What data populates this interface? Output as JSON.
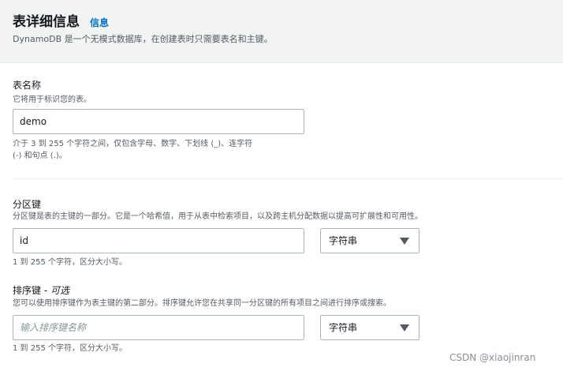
{
  "header": {
    "title": "表详细信息",
    "info_link": "信息",
    "description": "DynamoDB 是一个无模式数据库，在创建表时只需要表名和主键。"
  },
  "table_name": {
    "label": "表名称",
    "description": "它将用于标识您的表。",
    "value": "demo",
    "hint_line1": "介于 3 到 255 个字符之间，仅包含字母、数字、下划线 (_)、连字符",
    "hint_line2": "(-) 和句点 (.)。"
  },
  "partition_key": {
    "label": "分区键",
    "description": "分区键是表的主键的一部分。它是一个哈希值，用于从表中检索项目，以及跨主机分配数据以提高可扩展性和可用性。",
    "value": "id",
    "type_value": "字符串",
    "hint": "1 到 255 个字符，区分大小写。"
  },
  "sort_key": {
    "label": "排序键 - ",
    "label_optional": "可选",
    "description": "您可以使用排序键作为表主键的第二部分。排序键允许您在共享同一分区键的所有项目之间进行排序或搜索。",
    "value": "",
    "placeholder": "输入排序键名称",
    "type_value": "字符串",
    "hint": "1 到 255 个字符，区分大小写。"
  },
  "watermark": "CSDN @xiaojinran",
  "colors": {
    "header_bg": "#f2f3f3",
    "link": "#0073bb",
    "border": "#aab7b8",
    "muted_text": "#545b64"
  }
}
